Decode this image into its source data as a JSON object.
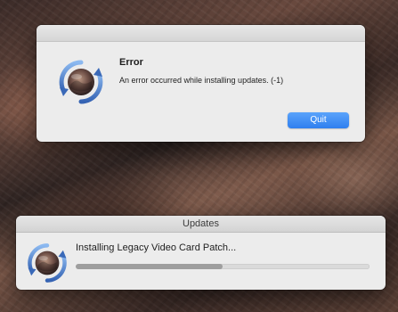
{
  "error_dialog": {
    "icon": "update-cycle-icon",
    "title": "Error",
    "message": "An error occurred while installing updates. (-1)",
    "quit_label": "Quit",
    "accent_color": "#2f7fef"
  },
  "updates_window": {
    "title": "Updates",
    "icon": "update-cycle-icon",
    "status": "Installing Legacy Video Card Patch...",
    "progress_fraction": 0.5
  }
}
